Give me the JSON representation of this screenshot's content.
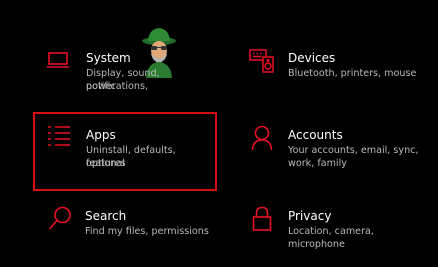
{
  "accent_color": "#e81123",
  "highlight_color": "#d40f14",
  "tiles": [
    {
      "id": "system",
      "icon": "laptop-icon",
      "title": "System",
      "desc_line1": "Display, sound, notifications,",
      "desc_line2": "power"
    },
    {
      "id": "devices",
      "icon": "keyboard-speaker-icon",
      "title": "Devices",
      "desc_line1": "Bluetooth, printers, mouse",
      "desc_line2": ""
    },
    {
      "id": "apps",
      "icon": "apps-list-icon",
      "title": "Apps",
      "desc_line1": "Uninstall, defaults, optional",
      "desc_line2": "features"
    },
    {
      "id": "accounts",
      "icon": "person-icon",
      "title": "Accounts",
      "desc_line1": "Your accounts, email, sync,",
      "desc_line2": "work, family"
    },
    {
      "id": "search",
      "icon": "search-icon",
      "title": "Search",
      "desc_line1": "Find my files, permissions",
      "desc_line2": ""
    },
    {
      "id": "privacy",
      "icon": "lock-icon",
      "title": "Privacy",
      "desc_line1": "Location, camera, microphone",
      "desc_line2": ""
    }
  ]
}
